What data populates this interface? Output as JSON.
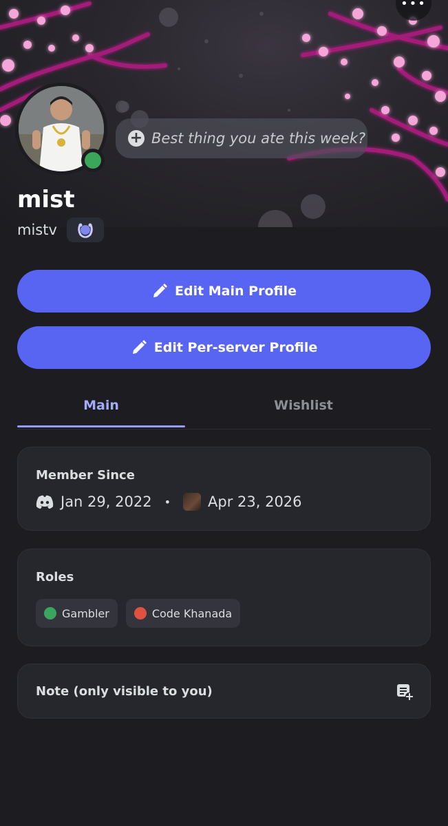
{
  "profile": {
    "display_name": "mist",
    "username": "mistv",
    "status_placeholder": "Best thing you ate this week?",
    "online_status_color": "#3ba55c",
    "accent_color": "#5865f2",
    "badge_icon": "laurel-badge-icon"
  },
  "header": {
    "more_label": "•••"
  },
  "actions": {
    "edit_main": "Edit Main Profile",
    "edit_server": "Edit Per-server Profile"
  },
  "tabs": [
    {
      "label": "Main",
      "active": true
    },
    {
      "label": "Wishlist",
      "active": false
    }
  ],
  "member_since": {
    "title": "Member Since",
    "discord_date": "Jan 29, 2022",
    "separator": "•",
    "server_date": "Apr 23, 2026"
  },
  "roles": {
    "title": "Roles",
    "items": [
      {
        "name": "Gambler",
        "color": "#3ba55c"
      },
      {
        "name": "Code Khanada",
        "color": "#e0523f"
      }
    ]
  },
  "note": {
    "title": "Note (only visible to you)"
  }
}
